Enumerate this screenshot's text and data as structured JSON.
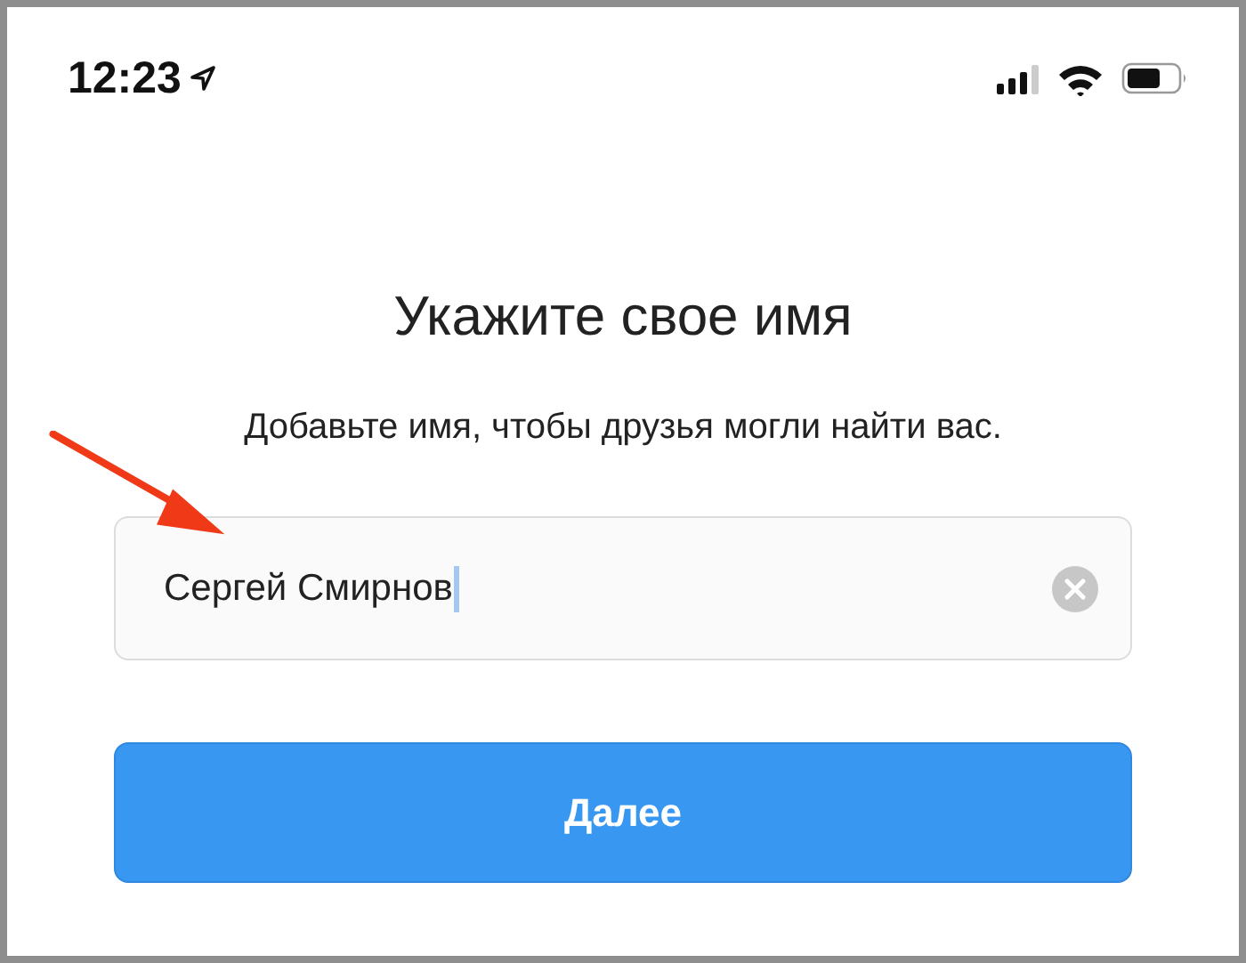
{
  "status_bar": {
    "time": "12:23"
  },
  "title": "Укажите свое имя",
  "subtitle": "Добавьте имя, чтобы друзья могли найти вас.",
  "name_field": {
    "value": "Сергей Смирнов",
    "focused": true
  },
  "next_button": {
    "label": "Далее"
  }
}
